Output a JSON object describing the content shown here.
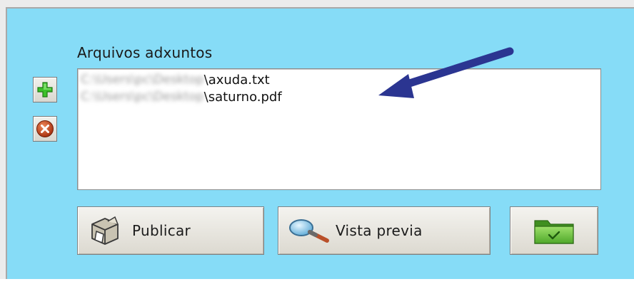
{
  "attachments": {
    "label": "Arquivos adxuntos",
    "files": [
      {
        "path_blurred": "C:\\Users\\pc\\Desktop",
        "name": "\\axuda.txt"
      },
      {
        "path_blurred": "C:\\Users\\pc\\Desktop",
        "name": "\\saturno.pdf"
      }
    ]
  },
  "side_buttons": {
    "add_icon": "green-plus-icon",
    "remove_icon": "red-x-circle-icon"
  },
  "actions": {
    "publish_label": "Publicar",
    "publish_icon": "package-box-icon",
    "preview_label": "Vista previa",
    "preview_icon": "magnifier-icon",
    "ok_icon": "green-folder-check-icon"
  },
  "colors": {
    "panel_bg": "#86dcf7",
    "arrow": "#2b3591",
    "plus_green": "#3cc02a",
    "remove_red": "#c2401d",
    "folder_green": "#6cc43a"
  }
}
